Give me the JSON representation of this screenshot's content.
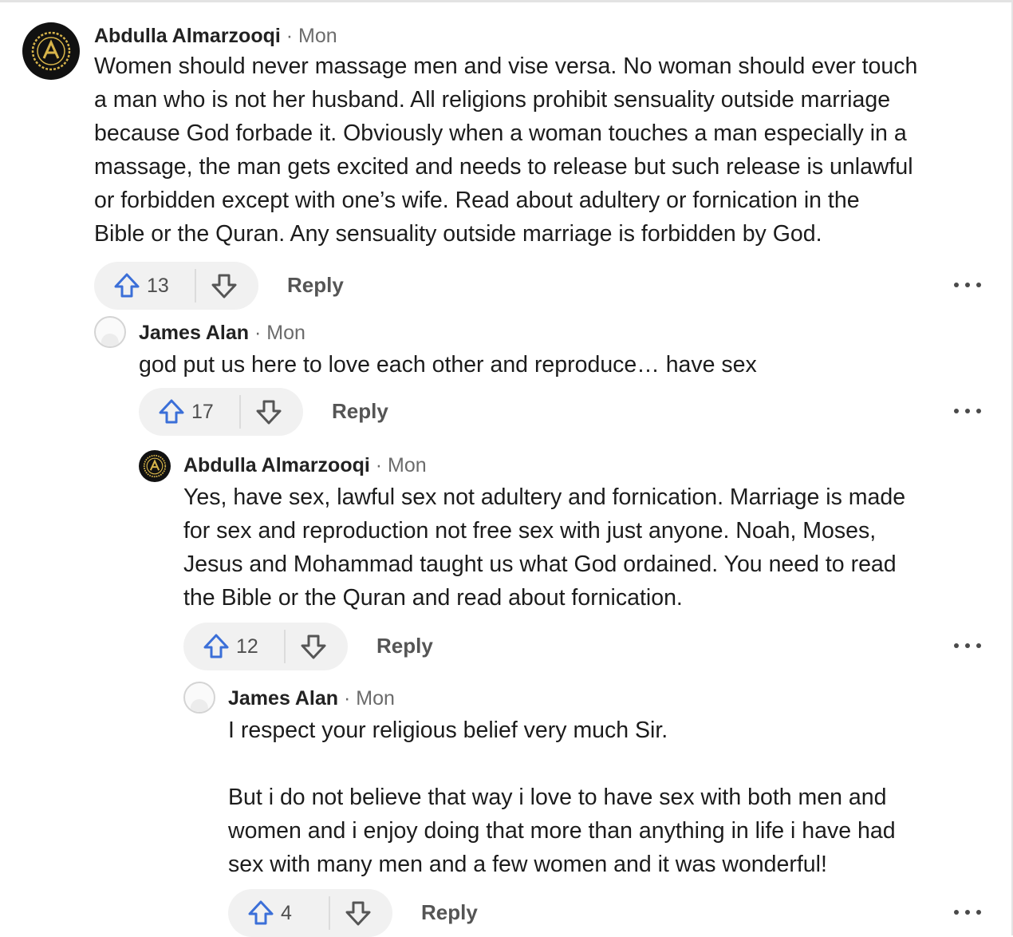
{
  "comments": [
    {
      "author": "Abdulla Almarzooqi",
      "separator": "·",
      "time": "Mon",
      "avatar": "gold-letter-a-logo",
      "body": "Women should never massage men and vise versa. No woman should ever touch\na man who is not her husband. All religions prohibit sensuality outside marriage\nbecause God forbade it. Obviously when a woman touches a man especially in a\nmassage, the man gets excited and needs to release but such release is unlawful\nor forbidden except with one’s wife. Read about adultery or fornication in the\nBible or the Quran. Any sensuality outside marriage is forbidden by God.",
      "votes": "13",
      "reply_label": "Reply"
    },
    {
      "author": "James Alan",
      "separator": "·",
      "time": "Mon",
      "avatar": "default-user-avatar",
      "body": "god put us here to love each other and reproduce… have sex",
      "votes": "17",
      "reply_label": "Reply"
    },
    {
      "author": "Abdulla Almarzooqi",
      "separator": "·",
      "time": "Mon",
      "avatar": "gold-letter-a-logo",
      "body": "Yes, have sex, lawful sex not adultery and fornication. Marriage is made\nfor sex and reproduction not free sex with just anyone. Noah, Moses,\nJesus and Mohammad taught us what God ordained. You need to read\nthe Bible or the Quran and read about fornication.",
      "votes": "12",
      "reply_label": "Reply"
    },
    {
      "author": "James Alan",
      "separator": "·",
      "time": "Mon",
      "avatar": "default-user-avatar",
      "body": "I respect your religious belief very much Sir.\n\nBut i do not believe that way i love to have sex with both men and\nwomen and i enjoy doing that more than anything in life i have had\nsex with many men and a few women and it was wonderful!",
      "votes": "4",
      "reply_label": "Reply"
    }
  ],
  "icons": {
    "upvote": "arrow-up-outline-icon",
    "downvote": "arrow-down-outline-icon",
    "more": "more-horizontal-icon"
  },
  "colors": {
    "upvote_accent": "#3b6fd8",
    "avatar_logo_bg": "#111111",
    "avatar_logo_gold": "#d7b44a",
    "pill_bg": "#f1f1f1",
    "muted_text": "#6b6b6b"
  }
}
